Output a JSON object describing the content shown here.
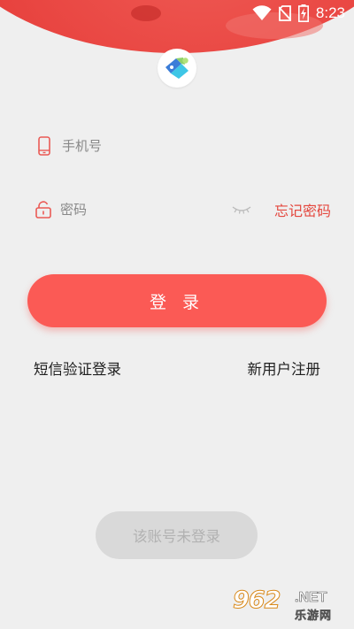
{
  "status_bar": {
    "time": "8:23",
    "icons": [
      "wifi-icon",
      "no-sim-icon",
      "battery-charging-icon"
    ]
  },
  "logo": {
    "icon": "app-logo-icon"
  },
  "phone_field": {
    "placeholder": "手机号",
    "icon": "phone-icon"
  },
  "password_field": {
    "placeholder": "密码",
    "icon": "unlock-icon",
    "toggle_icon": "eye-closed-icon"
  },
  "forgot_password": "忘记密码",
  "login_button": "登 录",
  "sms_login": "短信验证登录",
  "register": "新用户注册",
  "not_logged_button": "该账号未登录",
  "watermark": {
    "number": "962",
    "domain": ".NET",
    "site": "乐游网"
  },
  "colors": {
    "accent": "#fb5a55",
    "accent_text": "#e4483f",
    "background": "#efefef",
    "disabled": "#d9d9d9"
  }
}
